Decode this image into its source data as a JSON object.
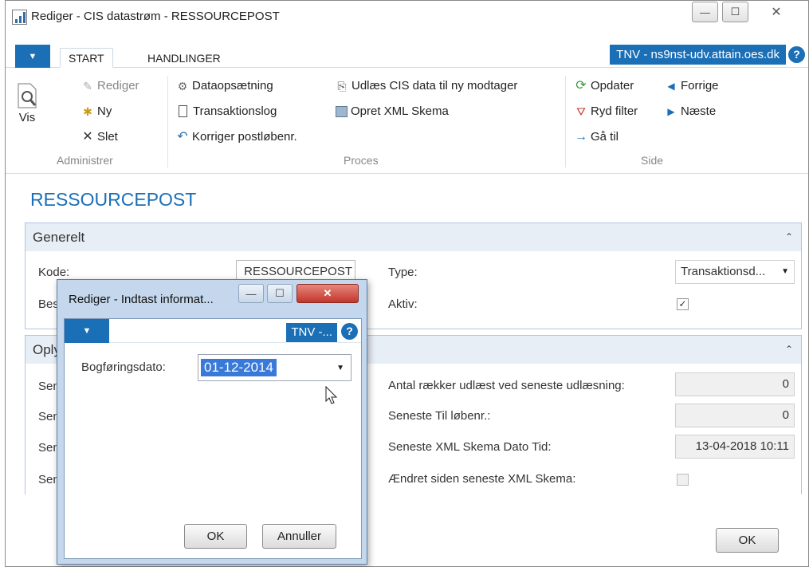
{
  "window": {
    "title": "Rediger - CIS datastrøm - RESSOURCEPOST",
    "controls": {
      "minimize": "—",
      "maximize": "☐",
      "close": "✕"
    }
  },
  "tabs": {
    "menu_icon": "caret-down-icon",
    "items": [
      "START",
      "HANDLINGER"
    ],
    "server": "TNV - ns9nst-udv.attain.oes.dk",
    "help": "?"
  },
  "ribbon": {
    "vis": "Vis",
    "rediger": "Rediger",
    "ny": "Ny",
    "slet": "Slet",
    "dataopsaetning": "Dataopsætning",
    "transaktionslog": "Transaktionslog",
    "korriger": "Korriger postløbenr.",
    "udlaes": "Udlæs CIS data til ny modtager",
    "opret_xml": "Opret XML Skema",
    "opdater": "Opdater",
    "ryd_filter": "Ryd filter",
    "gaa_til": "Gå til",
    "forrige": "Forrige",
    "naeste": "Næste",
    "groups": {
      "administrer": "Administrer",
      "proces": "Proces",
      "side": "Side"
    }
  },
  "page": {
    "title": "RESSOURCEPOST"
  },
  "generelt": {
    "header": "Generelt",
    "kode_label": "Kode:",
    "kode_value": "RESSOURCEPOST",
    "beskrivelse_label": "Bes",
    "type_label": "Type:",
    "type_value": "Transaktionsd...",
    "aktiv_label": "Aktiv:",
    "aktiv_mark": "✓"
  },
  "oplysninger": {
    "header": "Oply",
    "left_labels": [
      "Sen",
      "Sen",
      "Sen",
      "Sen"
    ],
    "antal_label": "Antal rækker udlæst ved seneste udlæsning:",
    "antal_value": "0",
    "til_label": "Seneste Til løbenr.:",
    "til_value": "0",
    "xml_label": "Seneste XML Skema Dato Tid:",
    "xml_value": "13-04-2018 10:11",
    "aendret_label": "Ændret siden seneste XML Skema:"
  },
  "main_ok": "OK",
  "dialog": {
    "title": "Rediger - Indtast informat...",
    "server": "TNV -...",
    "help": "?",
    "date_label": "Bogføringsdato:",
    "date_value": "01-12-2014",
    "ok": "OK",
    "cancel": "Annuller",
    "controls": {
      "minimize": "—",
      "maximize": "☐",
      "close": "✕"
    }
  },
  "colors": {
    "accent": "#1a6fb7",
    "selection": "#3879d9",
    "dialog_frame": "#c5d7ec",
    "close_red": "#c9463d"
  }
}
